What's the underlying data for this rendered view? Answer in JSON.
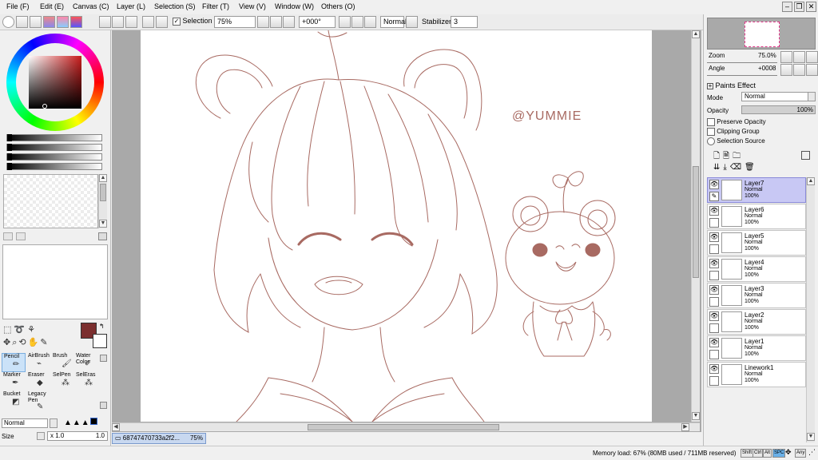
{
  "menubar": {
    "items": [
      "File (F)",
      "Edit (E)",
      "Canvas (C)",
      "Layer (L)",
      "Selection (S)",
      "Filter (T)",
      "View (V)",
      "Window (W)",
      "Others (O)"
    ]
  },
  "toolbar": {
    "selection_label": "Selection",
    "zoom_value": "75%",
    "angle_value": "+000°",
    "blend_mode": "Normal",
    "stabilizer_label": "Stabilizer",
    "stabilizer_value": "3"
  },
  "tools": {
    "items": [
      "Pencil",
      "AirBrush",
      "Brush",
      "Water Color",
      "Marker",
      "Eraser",
      "SelPen",
      "SelEras",
      "Bucket",
      "Legacy Pen"
    ],
    "mode": "Normal",
    "size_label": "Size",
    "size_multiplier": "x 1.0",
    "size_value": "1.0",
    "primary_color": "#7b2f2f"
  },
  "canvas": {
    "watermark": "@YUMMIE",
    "line_color": "#a86a62"
  },
  "navigator": {
    "zoom_label": "Zoom",
    "zoom_value": "75.0%",
    "angle_label": "Angle",
    "angle_value": "+0008"
  },
  "layer_props": {
    "paints_effect": "Paints Effect",
    "mode_label": "Mode",
    "mode_value": "Normal",
    "opacity_label": "Opacity",
    "opacity_value": "100%",
    "preserve_opacity": "Preserve Opacity",
    "clipping_group": "Clipping Group",
    "selection_source": "Selection Source"
  },
  "layers": [
    {
      "name": "Layer7",
      "mode": "Normal",
      "opacity": "100%",
      "active": true
    },
    {
      "name": "Layer6",
      "mode": "Normal",
      "opacity": "100%",
      "active": false
    },
    {
      "name": "Layer5",
      "mode": "Normal",
      "opacity": "100%",
      "active": false
    },
    {
      "name": "Layer4",
      "mode": "Normal",
      "opacity": "100%",
      "active": false
    },
    {
      "name": "Layer3",
      "mode": "Normal",
      "opacity": "100%",
      "active": false
    },
    {
      "name": "Layer2",
      "mode": "Normal",
      "opacity": "100%",
      "active": false
    },
    {
      "name": "Layer1",
      "mode": "Normal",
      "opacity": "100%",
      "active": false
    },
    {
      "name": "Linework1",
      "mode": "Normal",
      "opacity": "100%",
      "active": false
    }
  ],
  "statusbar": {
    "doc_tab_name": "68747470733a2f2...",
    "doc_tab_zoom": "75%",
    "memory": "Memory load: 67% (80MB used / 711MB reserved)",
    "keys": [
      "Shift",
      "Ctrl",
      "Alt",
      "SPC",
      "Any"
    ]
  }
}
